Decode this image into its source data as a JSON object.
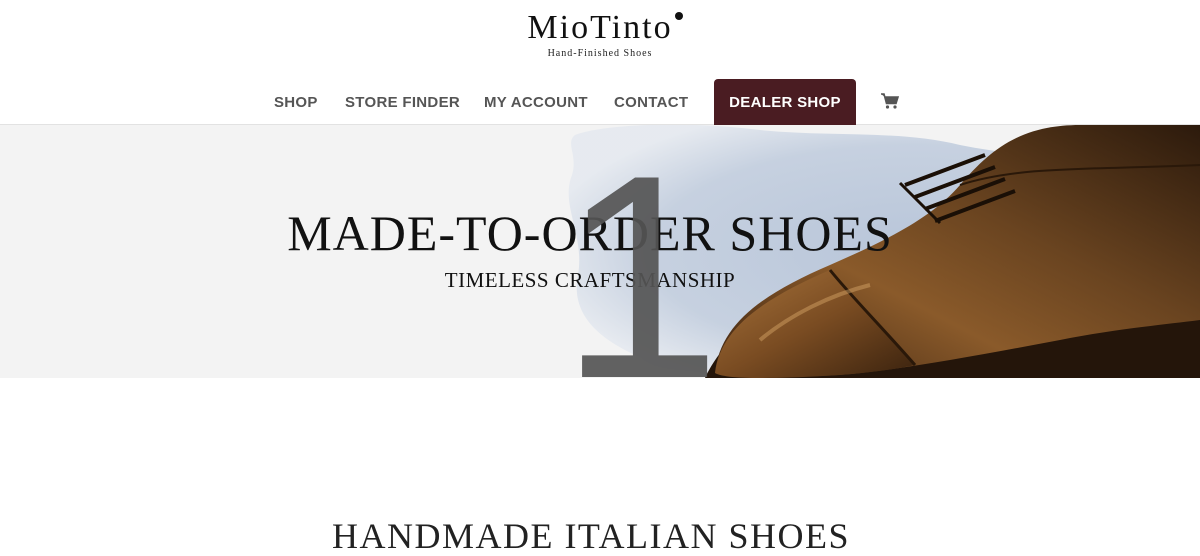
{
  "brand": {
    "name": "MioTinto",
    "tagline": "Hand-Finished Shoes"
  },
  "nav": {
    "items": [
      {
        "label": "SHOP"
      },
      {
        "label": "STORE FINDER"
      },
      {
        "label": "MY ACCOUNT"
      },
      {
        "label": "CONTACT"
      }
    ],
    "dealer_label": "DEALER SHOP",
    "cart_icon": "shopping-cart-icon"
  },
  "hero": {
    "title": "MADE-TO-ORDER SHOES",
    "subtitle": "TIMELESS CRAFTSMANSHIP",
    "slide_number": "1"
  },
  "section": {
    "heading": "HANDMADE ITALIAN SHOES"
  },
  "colors": {
    "dealer_bg": "#4a1c22",
    "nav_text": "#555555",
    "hero_bg": "#f3f3f3",
    "watercolor": "#aebbd0",
    "shoe_brown": "#6b4320"
  }
}
